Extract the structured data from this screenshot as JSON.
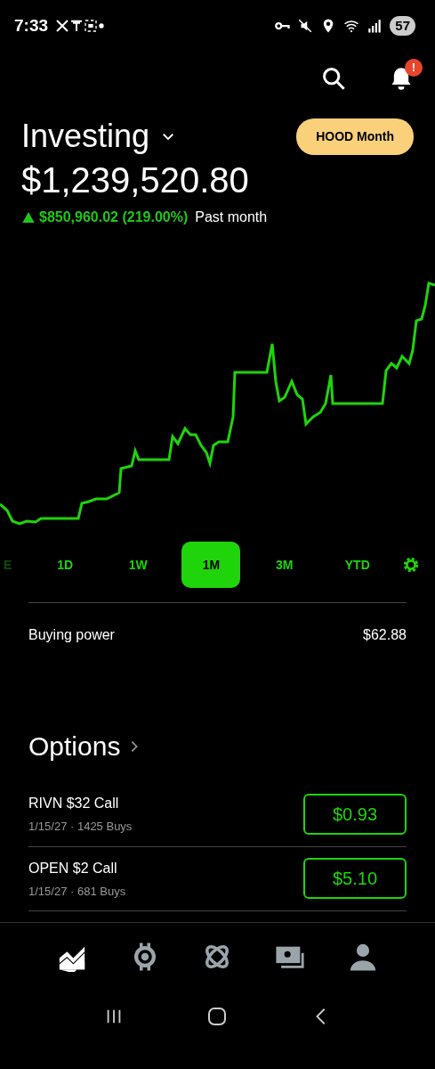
{
  "status_bar": {
    "time": "7:33",
    "battery": "57"
  },
  "header": {
    "notification_badge": "!"
  },
  "account": {
    "title": "Investing",
    "promo_button": "HOOD Month",
    "value": "$1,239,520.80",
    "change": "$850,960.02 (219.00%)",
    "period": "Past month"
  },
  "range_tabs": [
    {
      "label": "E",
      "selected": false,
      "cut": true
    },
    {
      "label": "1D",
      "selected": false
    },
    {
      "label": "1W",
      "selected": false
    },
    {
      "label": "1M",
      "selected": true
    },
    {
      "label": "3M",
      "selected": false
    },
    {
      "label": "YTD",
      "selected": false
    }
  ],
  "buying_power": {
    "label": "Buying power",
    "value": "$62.88"
  },
  "options": {
    "title": "Options",
    "items": [
      {
        "name": "RIVN $32 Call",
        "detail": "1/15/27 · 1425 Buys",
        "price": "$0.93"
      },
      {
        "name": "OPEN $2 Call",
        "detail": "1/15/27 · 681 Buys",
        "price": "$5.10"
      }
    ]
  },
  "bottom_nav": [
    {
      "kind": "portfolio",
      "selected": true
    },
    {
      "kind": "crypto",
      "selected": false
    },
    {
      "kind": "network",
      "selected": false
    },
    {
      "kind": "cash",
      "selected": false
    },
    {
      "kind": "account",
      "selected": false
    }
  ]
}
